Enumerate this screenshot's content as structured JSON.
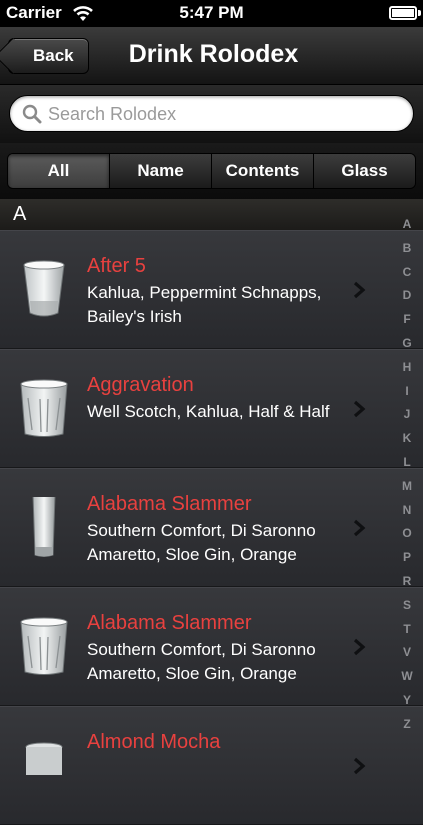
{
  "status_bar": {
    "carrier": "Carrier",
    "time": "5:47 PM"
  },
  "nav": {
    "back_label": "Back",
    "title": "Drink Rolodex"
  },
  "search": {
    "placeholder": "Search Rolodex",
    "value": ""
  },
  "segments": [
    "All",
    "Name",
    "Contents",
    "Glass"
  ],
  "selected_segment": "All",
  "section": {
    "title": "A"
  },
  "drinks": [
    {
      "name": "After 5",
      "contents": "Kahlua, Peppermint Schnapps, Bailey's Irish",
      "glass_icon": "shot-glass-icon"
    },
    {
      "name": "Aggravation",
      "contents": "Well Scotch, Kahlua, Half & Half",
      "glass_icon": "rocks-glass-icon"
    },
    {
      "name": "Alabama Slammer",
      "contents": "Southern Comfort, Di Saronno Amaretto, Sloe Gin, Orange",
      "glass_icon": "highball-glass-icon"
    },
    {
      "name": "Alabama Slammer",
      "contents": "Southern Comfort, Di Saronno Amaretto, Sloe Gin, Orange",
      "glass_icon": "rocks-glass-icon"
    },
    {
      "name": "Almond Mocha",
      "contents": "",
      "glass_icon": "mug-icon"
    }
  ],
  "index_letters": [
    "A",
    "B",
    "C",
    "D",
    "F",
    "G",
    "H",
    "I",
    "J",
    "K",
    "L",
    "M",
    "N",
    "O",
    "P",
    "R",
    "S",
    "T",
    "V",
    "W",
    "Y",
    "Z"
  ],
  "colors": {
    "accent_red": "#e8413f",
    "background": "#2b2c30"
  }
}
